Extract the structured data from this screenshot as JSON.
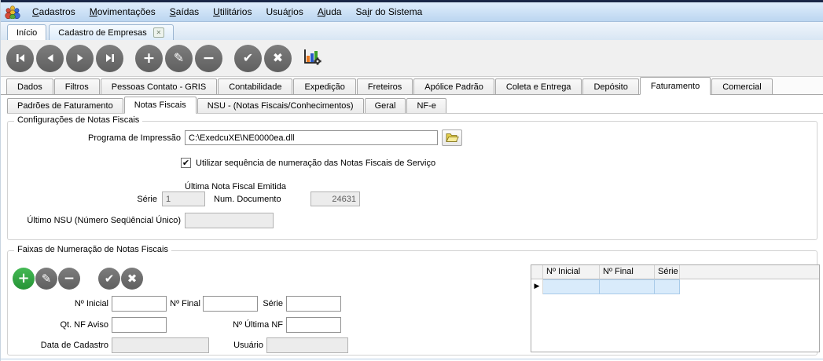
{
  "menubar": {
    "items": [
      {
        "pre": "",
        "key": "C",
        "post": "adastros"
      },
      {
        "pre": "",
        "key": "M",
        "post": "ovimentações"
      },
      {
        "pre": "",
        "key": "S",
        "post": "aídas"
      },
      {
        "pre": "",
        "key": "U",
        "post": "tilitários"
      },
      {
        "pre": "Usuá",
        "key": "r",
        "post": "ios"
      },
      {
        "pre": "",
        "key": "A",
        "post": "juda"
      },
      {
        "pre": "Sa",
        "key": "i",
        "post": "r do Sistema"
      }
    ]
  },
  "window_tabs": {
    "items": [
      {
        "label": "Início",
        "closable": false
      },
      {
        "label": "Cadastro de Empresas",
        "closable": true
      }
    ]
  },
  "icons": {
    "close_tab": "✕",
    "add": "+",
    "edit": "✎",
    "delete": "−",
    "confirm": "✔",
    "cancel": "✖",
    "check": "✔",
    "row_marker": "▶"
  },
  "toolbar": {
    "buttons": [
      "first-record",
      "previous-record",
      "next-record",
      "last-record",
      "insert-record",
      "edit-record",
      "delete-record",
      "confirm",
      "cancel",
      "chart-settings"
    ]
  },
  "main_tabs": {
    "active_index": 9,
    "items": [
      "Dados",
      "Filtros",
      "Pessoas Contato - GRIS",
      "Contabilidade",
      "Expedição",
      "Freteiros",
      "Apólice Padrão",
      "Coleta e Entrega",
      "Depósito",
      "Faturamento",
      "Comercial"
    ]
  },
  "sub_tabs": {
    "active_index": 1,
    "items": [
      "Padrões de Faturamento",
      "Notas Fiscais",
      "NSU - (Notas Fiscais/Conhecimentos)",
      "Geral",
      "NF-e"
    ]
  },
  "config_group": {
    "title": "Configurações de Notas Fiscais",
    "programa_label": "Programa de Impressão",
    "programa_value": "C:\\ExedcuXE\\NE0000ea.dll",
    "checkbox_label": "Utilizar sequência de numeração das Notas Fiscais de Serviço",
    "checkbox_checked": true,
    "ultima_nf_label": "Última Nota Fiscal Emitida",
    "serie_label": "Série",
    "serie_value": "1",
    "num_doc_label": "Num. Documento",
    "num_doc_value": "24631",
    "ultimo_nsu_label": "Último NSU (Número Seqüêncial Único)",
    "ultimo_nsu_value": ""
  },
  "faixas_group": {
    "title": "Faixas de Numeração de Notas Fiscais",
    "n_inicial_label": "Nº Inicial",
    "n_inicial_value": "",
    "n_final_label": "Nº Final",
    "n_final_value": "",
    "serie_label": "Série",
    "serie_value": "",
    "qt_nf_aviso_label": "Qt. NF Aviso",
    "qt_nf_aviso_value": "",
    "n_ultima_nf_label": "Nº Última NF",
    "n_ultima_nf_value": "",
    "data_cadastro_label": "Data de Cadastro",
    "data_cadastro_value": "",
    "usuario_label": "Usuário",
    "usuario_value": "",
    "grid": {
      "columns": [
        "Nº Inicial",
        "Nº Final",
        "Série"
      ],
      "rows": [
        {
          "selected": true,
          "cells": [
            "",
            "",
            ""
          ]
        }
      ]
    }
  }
}
